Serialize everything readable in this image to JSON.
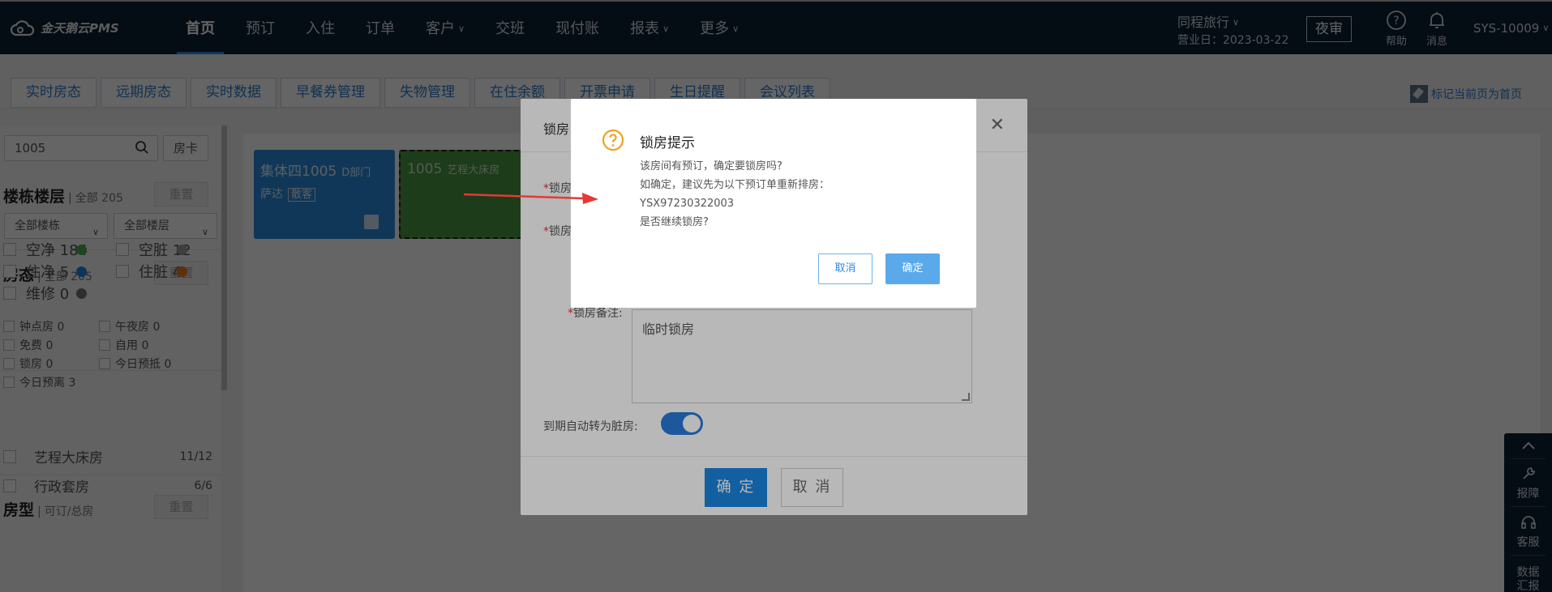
{
  "app": {
    "logo_text": "金天鹅云PMS"
  },
  "nav": {
    "items": [
      {
        "label": "首页",
        "active": true,
        "dropdown": false
      },
      {
        "label": "预订",
        "dropdown": false
      },
      {
        "label": "入住",
        "dropdown": false
      },
      {
        "label": "订单",
        "dropdown": false
      },
      {
        "label": "客户",
        "dropdown": true
      },
      {
        "label": "交班",
        "dropdown": false
      },
      {
        "label": "现付账",
        "dropdown": false
      },
      {
        "label": "报表",
        "dropdown": true
      },
      {
        "label": "更多",
        "dropdown": true
      }
    ]
  },
  "header": {
    "store": "同程旅行",
    "business_date": "营业日：2023-03-22",
    "night_audit": "夜审",
    "help": "帮助",
    "messages": "消息",
    "user": "SYS-10009"
  },
  "tabs": [
    "实时房态",
    "远期房态",
    "实时数据",
    "早餐券管理",
    "失物管理",
    "在住余额",
    "开票申请",
    "生日提醒",
    "会议列表"
  ],
  "pin_label": "标记当前页为首页",
  "sidebar": {
    "search_value": "1005",
    "room_card": "房卡",
    "building": {
      "title": "楼栋楼层",
      "total": "全部 205",
      "reset": "重置",
      "building_select": "全部楼栋",
      "floor_select": "全部楼层"
    },
    "status": {
      "title": "房态",
      "total": "全部 205",
      "reset": "重置",
      "items": [
        {
          "label": "空净 184",
          "color": "#4caf50"
        },
        {
          "label": "空脏 12",
          "color": "#9e9e9e"
        },
        {
          "label": "住净 5",
          "color": "#1e88e5"
        },
        {
          "label": "住脏 4",
          "color": "#ef7d1a"
        },
        {
          "label": "维修 0",
          "color": "#757575"
        }
      ]
    },
    "small_filters": [
      "钟点房 0",
      "午夜房 0",
      "免费 0",
      "自用 0",
      "锁房 0",
      "今日预抵 0",
      "今日预离 3"
    ],
    "room_types": {
      "title": "房型",
      "subtitle": "可订/总房",
      "reset": "重置",
      "items": [
        {
          "label": "艺程大床房",
          "count": "11/12"
        },
        {
          "label": "行政套房",
          "count": "6/6"
        }
      ]
    }
  },
  "rooms": [
    {
      "number": "集体四1005",
      "type": "D部门",
      "guest": "萨达",
      "tag": "散客"
    },
    {
      "number": "1005",
      "type": "艺程大床房"
    }
  ],
  "lock_modal": {
    "title": "锁房",
    "field1_label": "锁房",
    "field2_label": "锁房",
    "remark_label": "锁房备注:",
    "remark_value": "临时锁房",
    "auto_dirty_label": "到期自动转为脏房:",
    "auto_dirty_on": true,
    "confirm": "确 定",
    "cancel": "取 消"
  },
  "alert": {
    "title": "锁房提示",
    "lines": [
      "该房间有预订，确定要锁房吗?",
      "如确定，建议先为以下预订单重新排房：",
      "YSX97230322003",
      "是否继续锁房?"
    ],
    "cancel": "取消",
    "confirm": "确定"
  },
  "float_panel": {
    "items": [
      "报障",
      "客服",
      "数据汇报"
    ]
  }
}
